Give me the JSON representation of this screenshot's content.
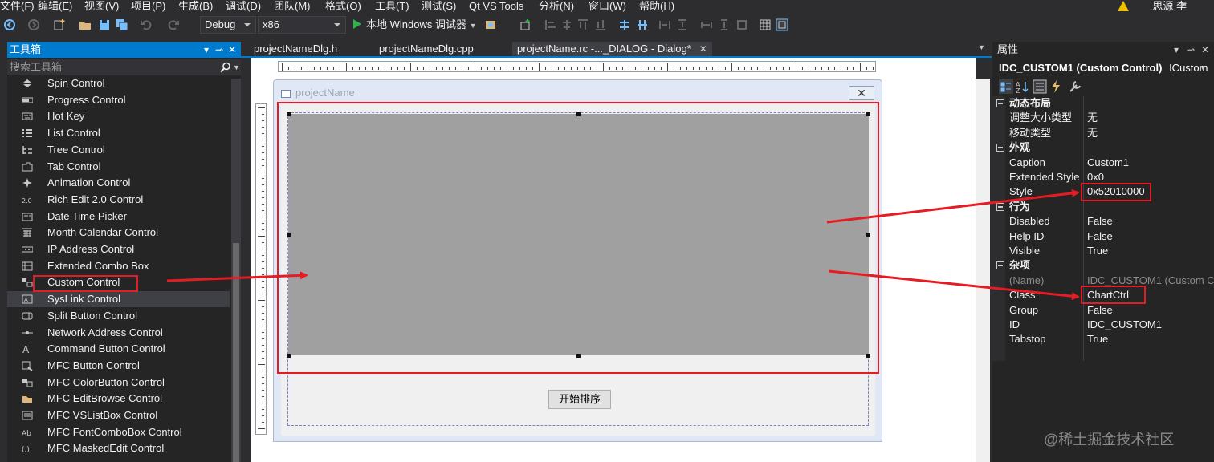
{
  "menu": {
    "items": [
      "文件(F)",
      "编辑(E)",
      "视图(V)",
      "项目(P)",
      "生成(B)",
      "调试(D)",
      "团队(M)",
      "格式(O)",
      "工具(T)",
      "测试(S)",
      "Qt VS Tools",
      "分析(N)",
      "窗口(W)",
      "帮助(H)"
    ],
    "user": "思源 李"
  },
  "toolbar": {
    "config": "Debug",
    "platform": "x86",
    "debugger": "本地 Windows 调试器"
  },
  "toolbox": {
    "title": "工具箱",
    "search_placeholder": "搜索工具箱",
    "items": [
      {
        "label": "Spin Control",
        "icon": "spin-icon"
      },
      {
        "label": "Progress Control",
        "icon": "progress-icon"
      },
      {
        "label": "Hot Key",
        "icon": "hotkey-icon"
      },
      {
        "label": "List Control",
        "icon": "list-icon"
      },
      {
        "label": "Tree Control",
        "icon": "tree-icon"
      },
      {
        "label": "Tab Control",
        "icon": "tab-icon"
      },
      {
        "label": "Animation Control",
        "icon": "animation-icon"
      },
      {
        "label": "Rich Edit 2.0 Control",
        "icon": "richedit-icon"
      },
      {
        "label": "Date Time Picker",
        "icon": "datetime-icon"
      },
      {
        "label": "Month Calendar Control",
        "icon": "calendar-icon"
      },
      {
        "label": "IP Address Control",
        "icon": "ip-icon"
      },
      {
        "label": "Extended Combo Box",
        "icon": "combo-icon"
      },
      {
        "label": "Custom Control",
        "icon": "custom-icon"
      },
      {
        "label": "SysLink Control",
        "icon": "syslink-icon"
      },
      {
        "label": "Split Button Control",
        "icon": "split-icon"
      },
      {
        "label": "Network Address Control",
        "icon": "network-icon"
      },
      {
        "label": "Command Button Control",
        "icon": "command-icon"
      },
      {
        "label": "MFC Button Control",
        "icon": "mfc-button-icon"
      },
      {
        "label": "MFC ColorButton Control",
        "icon": "mfc-color-icon"
      },
      {
        "label": "MFC EditBrowse Control",
        "icon": "mfc-editbrowse-icon"
      },
      {
        "label": "MFC VSListBox Control",
        "icon": "mfc-vslist-icon"
      },
      {
        "label": "MFC FontComboBox Control",
        "icon": "mfc-font-icon"
      },
      {
        "label": "MFC MaskedEdit Control",
        "icon": "mfc-masked-icon"
      }
    ],
    "selected_index": 13
  },
  "tabs": [
    {
      "label": "projectNameDlg.h"
    },
    {
      "label": "projectNameDlg.cpp"
    },
    {
      "label": "projectName.rc -..._DIALOG - Dialog*",
      "active": true
    }
  ],
  "dialog": {
    "title": "projectName",
    "button_label": "开始排序"
  },
  "properties": {
    "title": "属性",
    "object_name": "IDC_CUSTOM1 (Custom Control)",
    "object_type": "ICustom",
    "categories": [
      {
        "name": "动态布局",
        "rows": [
          {
            "name": "调整大小类型",
            "value": "无"
          },
          {
            "name": "移动类型",
            "value": "无"
          }
        ]
      },
      {
        "name": "外观",
        "rows": [
          {
            "name": "Caption",
            "value": "Custom1"
          },
          {
            "name": "Extended Style",
            "value": "0x0"
          },
          {
            "name": "Style",
            "value": "0x52010000"
          }
        ]
      },
      {
        "name": "行为",
        "rows": [
          {
            "name": "Disabled",
            "value": "False"
          },
          {
            "name": "Help ID",
            "value": "False"
          },
          {
            "name": "Visible",
            "value": "True"
          }
        ]
      },
      {
        "name": "杂项",
        "rows": [
          {
            "name": "(Name)",
            "value": "IDC_CUSTOM1 (Custom Co",
            "dim": true
          },
          {
            "name": "Class",
            "value": "ChartCtrl"
          },
          {
            "name": "Group",
            "value": "False"
          },
          {
            "name": "ID",
            "value": "IDC_CUSTOM1"
          },
          {
            "name": "Tabstop",
            "value": "True"
          }
        ]
      }
    ]
  },
  "watermark": "@稀土掘金技术社区",
  "colors": {
    "accent": "#007acc",
    "annotation_red": "#e51c23",
    "custom_control_fill": "#a0a0a0"
  }
}
